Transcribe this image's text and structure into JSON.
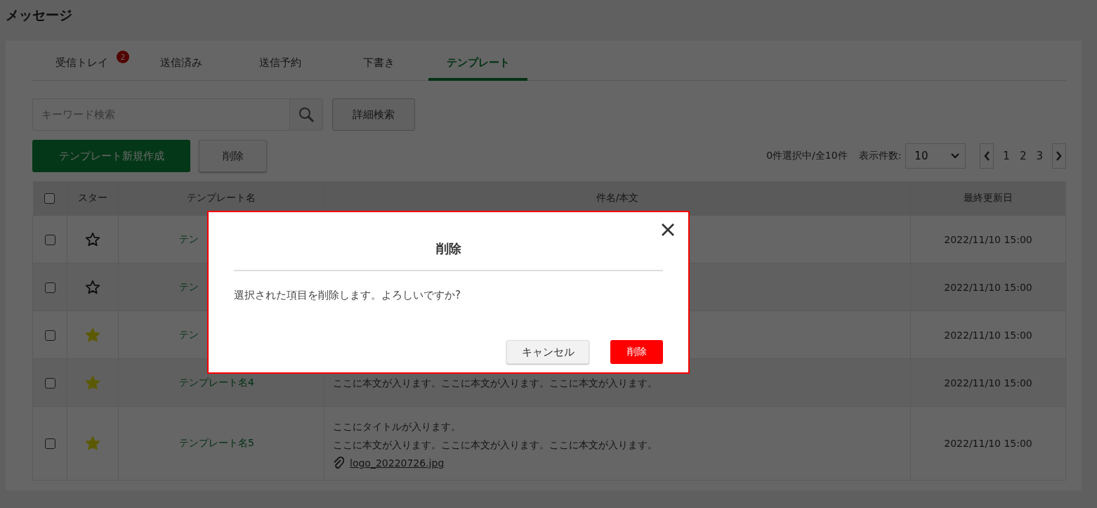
{
  "page_title": "メッセージ",
  "tabs": [
    {
      "label": "受信トレイ",
      "badge": "2",
      "selected": false
    },
    {
      "label": "送信済み",
      "selected": false
    },
    {
      "label": "送信予約",
      "selected": false
    },
    {
      "label": "下書き",
      "selected": false
    },
    {
      "label": "テンプレート",
      "selected": true
    }
  ],
  "search": {
    "placeholder": "キーワード検索"
  },
  "advanced_search_button": "詳細検索",
  "new_template_button": "テンプレート新規作成",
  "delete_button": "削除",
  "selection_info": "0件選択中/全10件",
  "per_page_label": "表示件数:",
  "per_page_value": "10",
  "pages": [
    "1",
    "2",
    "3"
  ],
  "table": {
    "columns": [
      "スター",
      "テンプレート名",
      "件名/本文",
      "最終更新日"
    ],
    "header_checked": false,
    "rows": [
      {
        "checked": false,
        "starred": false,
        "name": "テン",
        "lines": [],
        "date": "2022/11/10 15:00"
      },
      {
        "checked": false,
        "starred": false,
        "name": "テン",
        "lines": [],
        "date": "2022/11/10 15:00"
      },
      {
        "checked": false,
        "starred": true,
        "name": "テン",
        "lines": [],
        "date": "2022/11/10 15:00"
      },
      {
        "checked": false,
        "starred": true,
        "name": "テンプレート名4",
        "lines": [
          "ここに本文が入ります。ここに本文が入ります。ここに本文が入ります。"
        ],
        "date": "2022/11/10 15:00"
      },
      {
        "checked": false,
        "starred": true,
        "name": "テンプレート名5",
        "lines": [
          "ここにタイトルが入ります。",
          "ここに本文が入ります。ここに本文が入ります。ここに本文が入ります。"
        ],
        "attachment": "logo_20220726.jpg",
        "date": "2022/11/10 15:00"
      }
    ]
  },
  "modal": {
    "title": "削除",
    "message": "選択された項目を削除します。よろしいですか?",
    "cancel_button": "キャンセル",
    "confirm_button": "削除"
  }
}
